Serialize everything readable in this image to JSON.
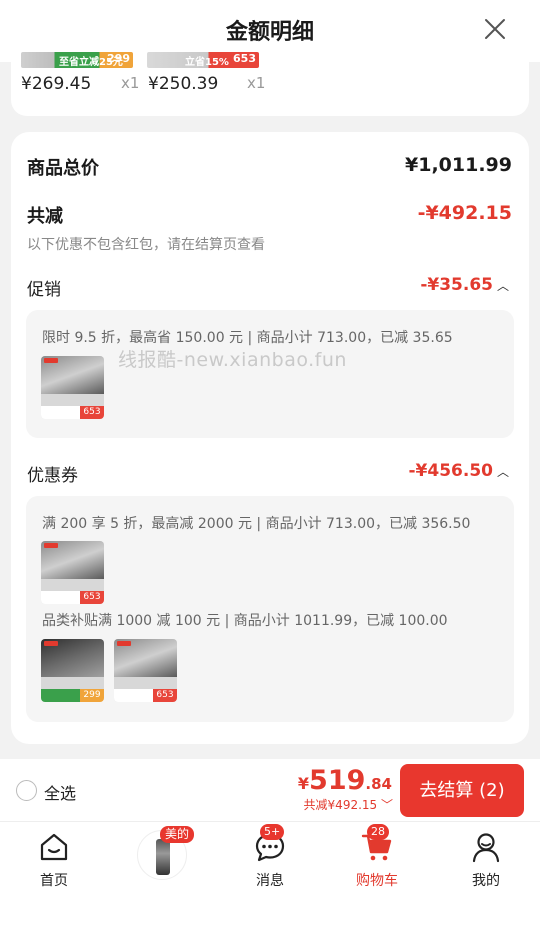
{
  "header": {
    "title": "金额明细"
  },
  "top_items": [
    {
      "price": "¥269.45",
      "qty": "x1",
      "thumb_price": "299",
      "thumb_promo": "至省立减25元"
    },
    {
      "price": "¥250.39",
      "qty": "x1",
      "thumb_price": "653",
      "thumb_promo": "立省15%"
    }
  ],
  "summary": {
    "total_label": "商品总价",
    "total_value": "¥1,011.99",
    "discount_label": "共减",
    "discount_value": "-¥492.15",
    "note": "以下优惠不包含红包，请在结算页查看"
  },
  "promotion": {
    "label": "促销",
    "value": "-¥35.65",
    "desc": "限时 9.5 折，最高省 150.00 元 | 商品小计 713.00，已减 35.65",
    "thumb_tag": "653"
  },
  "watermark": "线报酷-new.xianbao.fun",
  "coupon": {
    "label": "优惠券",
    "value": "-¥456.50",
    "desc1": "满 200 享 5 折，最高减 2000 元 | 商品小计 713.00，已减 356.50",
    "desc2": "品类补贴满 1000 减 100 元 | 商品小计 1011.99，已减 100.00",
    "thumb_tags": [
      "653",
      "299",
      "653"
    ]
  },
  "checkout": {
    "select_all": "全选",
    "currency": "¥",
    "total_int": "519",
    "total_dec": ".84",
    "saved": "共减¥492.15",
    "button": "去结算 (2)"
  },
  "tabbar": {
    "home": "首页",
    "midea_tag": "美的",
    "messages": "消息",
    "messages_badge": "5+",
    "cart": "购物车",
    "cart_badge": "28",
    "me": "我的"
  },
  "colors": {
    "accent": "#e23a2e",
    "button": "#e8372e"
  }
}
